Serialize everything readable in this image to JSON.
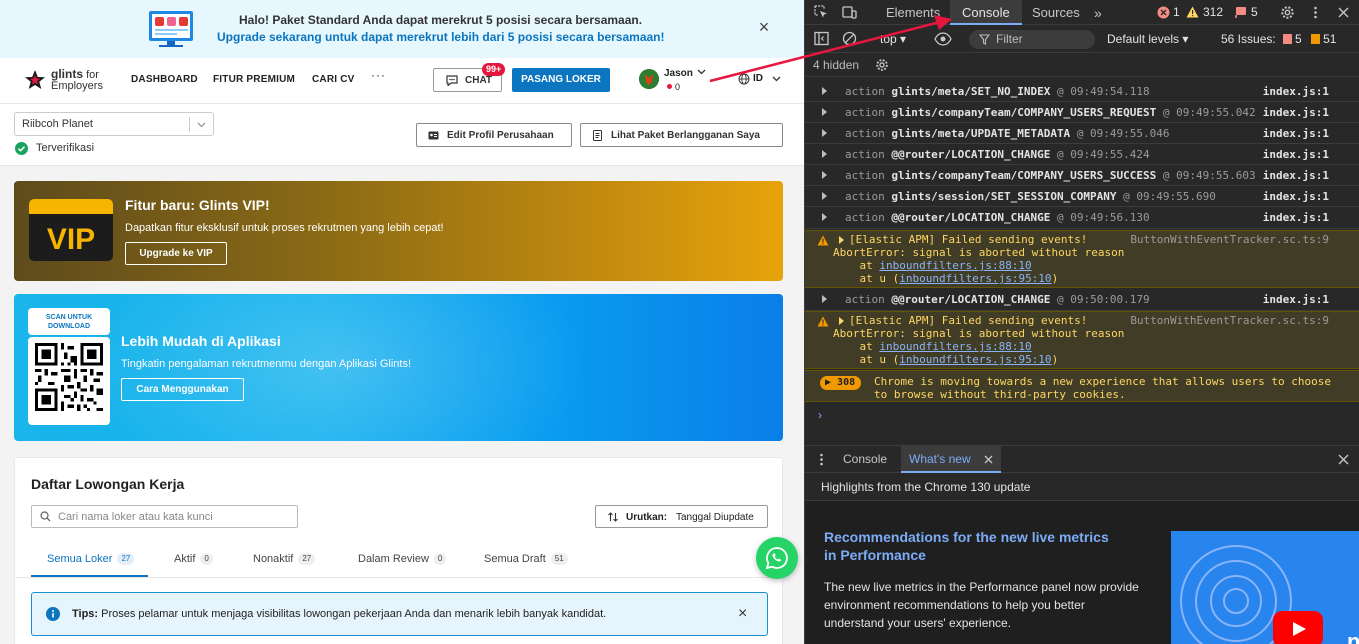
{
  "banner": {
    "line1": "Halo! Paket Standard Anda dapat merekrut 5 posisi secara bersamaan.",
    "line2": "Upgrade sekarang untuk dapat merekrut lebih dari 5 posisi secara bersamaan!",
    "close": "×"
  },
  "nav": {
    "logo_brand": "glints",
    "logo_for": "for",
    "logo_employers": "Employers",
    "links": [
      "DASHBOARD",
      "FITUR PREMIUM",
      "CARI CV"
    ],
    "more": "···",
    "chat_label": "CHAT",
    "chat_badge": "99+",
    "post_label": "PASANG LOKER",
    "user_name": "Jason",
    "user_coins": "0",
    "lang": "ID"
  },
  "company": {
    "name": "Riibcoh Planet",
    "verified": "Terverifikasi",
    "edit_profile": "Edit Profil Perusahaan",
    "view_package": "Lihat Paket Berlangganan Saya"
  },
  "vip": {
    "logo_text": "VIP",
    "title": "Fitur baru: Glints VIP!",
    "desc": "Dapatkan fitur eksklusif untuk proses rekrutmen yang lebih cepat!",
    "button": "Upgrade ke VIP"
  },
  "app_promo": {
    "scan_label": "SCAN UNTUK DOWNLOAD",
    "title": "Lebih Mudah di Aplikasi",
    "desc": "Tingkatin pengalaman rekrutmenmu dengan Aplikasi Glints!",
    "button": "Cara Menggunakan"
  },
  "jobs": {
    "title": "Daftar Lowongan Kerja",
    "search_placeholder": "Cari nama loker atau kata kunci",
    "sort_label": "Urutkan:",
    "sort_value": "Tanggal Diupdate",
    "tabs": [
      {
        "label": "Semua Loker",
        "count": "27"
      },
      {
        "label": "Aktif",
        "count": "0"
      },
      {
        "label": "Nonaktif",
        "count": "27"
      },
      {
        "label": "Dalam Review",
        "count": "0"
      },
      {
        "label": "Semua Draft",
        "count": "51"
      }
    ],
    "tips_label": "Tips:",
    "tips_text": "Proses pelamar untuk menjaga visibilitas lowongan pekerjaan Anda dan menarik lebih banyak kandidat.",
    "tips_close": "×"
  },
  "devtools": {
    "tabs": [
      "Elements",
      "Console",
      "Sources"
    ],
    "more": "»",
    "errors": "1",
    "warnings": "312",
    "issues_count": "5",
    "context": "top",
    "filter": "Filter",
    "levels": "Default levels",
    "issues_label": "56 Issues:",
    "issues_err": "5",
    "issues_info": "51",
    "hidden": "4 hidden",
    "logs": [
      {
        "kind": "action",
        "name": "glints/meta/SET_NO_INDEX",
        "time": "@ 09:49:54.118",
        "src": "index.js:1"
      },
      {
        "kind": "action",
        "name": "glints/companyTeam/COMPANY_USERS_REQUEST",
        "time": "@ 09:49:55.042",
        "src": "index.js:1"
      },
      {
        "kind": "action",
        "name": "glints/meta/UPDATE_METADATA",
        "time": "@ 09:49:55.046",
        "src": "index.js:1"
      },
      {
        "kind": "action",
        "name": "@@router/LOCATION_CHANGE",
        "time": "@ 09:49:55.424",
        "src": "index.js:1"
      },
      {
        "kind": "action",
        "name": "glints/companyTeam/COMPANY_USERS_SUCCESS",
        "time": "@ 09:49:55.603",
        "src": "index.js:1"
      },
      {
        "kind": "action",
        "name": "glints/session/SET_SESSION_COMPANY",
        "time": "@ 09:49:55.690",
        "src": "index.js:1"
      },
      {
        "kind": "action",
        "name": "@@router/LOCATION_CHANGE",
        "time": "@ 09:49:56.130",
        "src": "index.js:1"
      }
    ],
    "warn1": {
      "l1": "[Elastic APM] Failed sending events!",
      "src": "ButtonWithEventTracker.sc.ts:9",
      "l2": "AbortError: signal is aborted without reason",
      "l3a": "    at ",
      "l3b": "inboundfilters.js:88:10",
      "l4a": "    at u (",
      "l4b": "inboundfilters.js:95:10",
      "l4c": ")"
    },
    "log8": {
      "kind": "action",
      "name": "@@router/LOCATION_CHANGE",
      "time": "@ 09:50:00.179",
      "src": "index.js:1"
    },
    "warn2": {
      "l1": "[Elastic APM] Failed sending events!",
      "src": "ButtonWithEventTracker.sc.ts:9",
      "l2": "AbortError: signal is aborted without reason",
      "l3a": "    at ",
      "l3b": "inboundfilters.js:88:10",
      "l4a": "    at u (",
      "l4b": "inboundfilters.js:95:10",
      "l4c": ")"
    },
    "cookie": {
      "badge": "308",
      "l1": "Chrome is moving towards a new experience that allows users to choose",
      "l2": "to browse without third-party cookies."
    },
    "prompt": "›",
    "drawer_tabs": [
      "Console",
      "What's new"
    ],
    "highlights": "Highlights from the Chrome 130 update",
    "whatsnew_title": "Recommendations for the new live metrics in Performance",
    "whatsnew_body": "The new live metrics in the Performance panel now provide environment recommendations to help you better understand your users' experience.",
    "thumb_letter": "n"
  },
  "colors": {
    "primary": "#0b75bf",
    "vip_gold": "#e7a30a",
    "app_blue": "#10b0ee",
    "devtools_bg": "#282828",
    "annotation": "#e5173f"
  }
}
